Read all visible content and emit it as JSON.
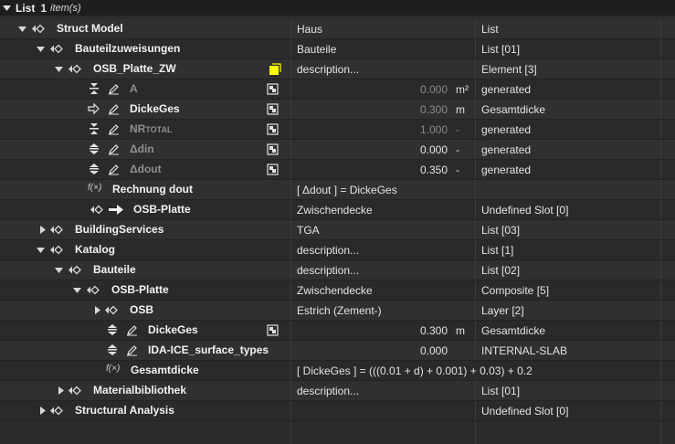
{
  "header": {
    "title": "List",
    "count": "1",
    "items_label": "item(s)"
  },
  "rows": [
    {
      "label": "Struct Model",
      "col2": "Haus",
      "col3": "List"
    },
    {
      "label": "Bauteilzuweisungen",
      "col2": "Bauteile",
      "col3": "List [01]"
    },
    {
      "label": "OSB_Platte_ZW",
      "col2": "description...",
      "col3": "Element [3]"
    },
    {
      "label": "A",
      "value": "0.000",
      "unit": "m²",
      "col3": "generated"
    },
    {
      "label": "DickeGes",
      "value": "0.300",
      "unit": "m",
      "col3": "Gesamtdicke"
    },
    {
      "label": "NR",
      "label_small": "TOTAL",
      "value": "1.000",
      "unit": "-",
      "col3": "generated"
    },
    {
      "label": "Δdin",
      "value": "0.000",
      "unit": "-",
      "col3": "generated"
    },
    {
      "label": "Δdout",
      "value": "0.350",
      "unit": "-",
      "col3": "generated"
    },
    {
      "func_prefix": "f(×)",
      "label": "Rechnung dout",
      "col2": "[ Δdout ] = DickeGes",
      "col3": ""
    },
    {
      "label": "OSB-Platte",
      "col2": "Zwischendecke",
      "col3": "Undefined Slot [0]"
    },
    {
      "label": "BuildingServices",
      "col2": "TGA",
      "col3": "List [03]"
    },
    {
      "label": "Katalog",
      "col2": "description...",
      "col3": "List [1]"
    },
    {
      "label": "Bauteile",
      "col2": "description...",
      "col3": "List [02]"
    },
    {
      "label": "OSB-Platte",
      "col2": "Zwischendecke",
      "col3": "Composite [5]"
    },
    {
      "label": "OSB",
      "col2": "Estrich (Zement-)",
      "col3": "Layer [2]"
    },
    {
      "label": "DickeGes",
      "value": "0.300",
      "unit": "m",
      "col3": "Gesamtdicke"
    },
    {
      "label": "IDA-ICE_surface_types",
      "value": "0.000",
      "unit": "",
      "col3": "INTERNAL-SLAB"
    },
    {
      "func_prefix": "f(×)",
      "label": "Gesamtdicke",
      "col2": "[ DickeGes ] = (((0.01 + d) + 0.001) + 0.03) + 0.2",
      "col3": ""
    },
    {
      "label": "Materialbibliothek",
      "col2": "description...",
      "col3": "List [01]"
    },
    {
      "label": "Structural Analysis",
      "col2": "",
      "col3": "Undefined Slot [0]"
    }
  ],
  "icons": {
    "expand": "triangle-down-icon",
    "collapse": "triangle-right-icon",
    "node": "node-diamond-icon",
    "attribute": "attribute-icon",
    "pencil": "pencil-icon",
    "slot": "slot-icon",
    "arrow": "arrow-right-icon",
    "formula": "formula-icon",
    "warning": "yellow-square-icon"
  },
  "colors": {
    "background": "#2b2b2b",
    "header": "#1e1e1e",
    "warning": "#ffff00"
  }
}
